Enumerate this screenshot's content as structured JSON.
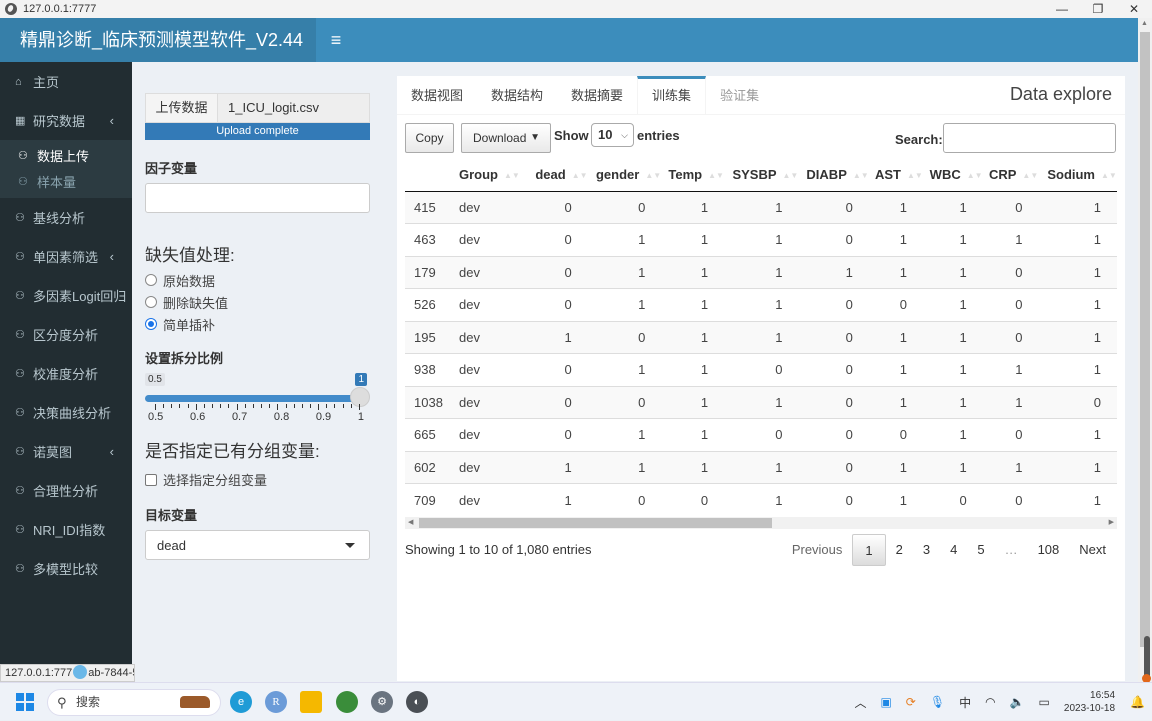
{
  "browser": {
    "url": "127.0.0.1:7777",
    "window_controls": [
      "—",
      "❐",
      "✕"
    ]
  },
  "app": {
    "title": "精鼎诊断_临床预测模型软件_V2.44",
    "menu_toggle": "≡"
  },
  "sidebar": {
    "items": [
      {
        "label": "主页",
        "icon": "home-icon",
        "glyph": "⌂"
      },
      {
        "label": "研究数据",
        "icon": "table-icon",
        "glyph": "▦",
        "chevron": "‹",
        "children": [
          {
            "label": "数据上传",
            "active": true
          },
          {
            "label": "样本量",
            "active": false
          }
        ]
      },
      {
        "label": "基线分析",
        "icon": "handshake-icon",
        "glyph": "⚇"
      },
      {
        "label": "单因素筛选",
        "icon": "handshake-icon",
        "glyph": "⚇",
        "chevron": "‹"
      },
      {
        "label": "多因素Logit回归",
        "icon": "handshake-icon",
        "glyph": "⚇"
      },
      {
        "label": "区分度分析",
        "icon": "handshake-icon",
        "glyph": "⚇"
      },
      {
        "label": "校准度分析",
        "icon": "handshake-icon",
        "glyph": "⚇"
      },
      {
        "label": "决策曲线分析",
        "icon": "handshake-icon",
        "glyph": "⚇"
      },
      {
        "label": "诺莫图",
        "icon": "handshake-icon",
        "glyph": "⚇",
        "chevron": "‹"
      },
      {
        "label": "合理性分析",
        "icon": "handshake-icon",
        "glyph": "⚇"
      },
      {
        "label": "NRI_IDI指数",
        "icon": "handshake-icon",
        "glyph": "⚇"
      },
      {
        "label": "多模型比较",
        "icon": "handshake-icon",
        "glyph": "⚇"
      }
    ],
    "status_url_left": "127.0.0.1:777",
    "status_url_right": "ab-7844-5"
  },
  "controls": {
    "upload_button": "上传数据",
    "file_name": "1_ICU_logit.csv",
    "upload_status": "Upload complete",
    "factor_label": "因子变量",
    "factor_value": "",
    "missing_title": "缺失值处理:",
    "missing_options": [
      {
        "label": "原始数据",
        "checked": false
      },
      {
        "label": "删除缺失值",
        "checked": false
      },
      {
        "label": "简单插补",
        "checked": true
      }
    ],
    "split_label": "设置拆分比例",
    "split_min": "0.5",
    "split_value": "1",
    "split_ticks": [
      "0.5",
      "0.6",
      "0.7",
      "0.8",
      "0.9",
      "1"
    ],
    "group_title": "是否指定已有分组变量:",
    "group_checkbox": "选择指定分组变量",
    "group_checked": false,
    "target_label": "目标变量",
    "target_value": "dead"
  },
  "main": {
    "box_title": "Data explore",
    "tabs": [
      {
        "label": "数据视图",
        "state": "normal"
      },
      {
        "label": "数据结构",
        "state": "normal"
      },
      {
        "label": "数据摘要",
        "state": "normal"
      },
      {
        "label": "训练集",
        "state": "active"
      },
      {
        "label": "验证集",
        "state": "hover"
      }
    ],
    "copy_button": "Copy",
    "download_button": "Download",
    "show_label": "Show",
    "page_length": "10",
    "entries_label": "entries",
    "search_label": "Search:",
    "search_value": "",
    "table": {
      "columns": [
        "",
        "Group",
        "dead",
        "gender",
        "Temp",
        "SYSBP",
        "DIABP",
        "AST",
        "WBC",
        "CRP",
        "Sodium"
      ],
      "rows": [
        [
          "415",
          "dev",
          "0",
          "0",
          "1",
          "1",
          "0",
          "1",
          "1",
          "0",
          "1"
        ],
        [
          "463",
          "dev",
          "0",
          "1",
          "1",
          "1",
          "0",
          "1",
          "1",
          "1",
          "1"
        ],
        [
          "179",
          "dev",
          "0",
          "1",
          "1",
          "1",
          "1",
          "1",
          "1",
          "0",
          "1"
        ],
        [
          "526",
          "dev",
          "0",
          "1",
          "1",
          "1",
          "0",
          "0",
          "1",
          "0",
          "1"
        ],
        [
          "195",
          "dev",
          "1",
          "0",
          "1",
          "1",
          "0",
          "1",
          "1",
          "0",
          "1"
        ],
        [
          "938",
          "dev",
          "0",
          "1",
          "1",
          "0",
          "0",
          "1",
          "1",
          "1",
          "1"
        ],
        [
          "1038",
          "dev",
          "0",
          "0",
          "1",
          "1",
          "0",
          "1",
          "1",
          "1",
          "0"
        ],
        [
          "665",
          "dev",
          "0",
          "1",
          "1",
          "0",
          "0",
          "0",
          "1",
          "0",
          "1"
        ],
        [
          "602",
          "dev",
          "1",
          "1",
          "1",
          "1",
          "0",
          "1",
          "1",
          "1",
          "1"
        ],
        [
          "709",
          "dev",
          "1",
          "0",
          "0",
          "1",
          "0",
          "1",
          "0",
          "0",
          "1"
        ]
      ]
    },
    "info": "Showing 1 to 10 of 1,080 entries",
    "pagination": {
      "previous": "Previous",
      "pages": [
        "1",
        "2",
        "3",
        "4",
        "5",
        "…",
        "108"
      ],
      "current": "1",
      "next": "Next"
    }
  },
  "taskbar": {
    "search_placeholder": "搜索",
    "apps": [
      "edge",
      "R",
      "file-explorer",
      "jingding-app",
      "settings",
      "browser"
    ],
    "tray_ime": "中",
    "time": "16:54",
    "date": "2023-10-18"
  },
  "colors": {
    "header": "#3c8dbc",
    "logo_bg": "#367fa9",
    "sidebar": "#222d32",
    "primary": "#337ab7"
  }
}
